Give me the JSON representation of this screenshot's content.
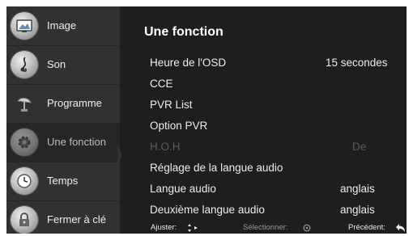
{
  "sidebar": {
    "items": [
      {
        "label": "Image",
        "icon": "image-icon"
      },
      {
        "label": "Son",
        "icon": "music-note-icon"
      },
      {
        "label": "Programme",
        "icon": "satellite-dish-icon"
      },
      {
        "label": "Une fonction",
        "icon": "gear-icon",
        "active": true
      },
      {
        "label": "Temps",
        "icon": "clock-icon"
      },
      {
        "label": "Fermer à clé",
        "icon": "lock-icon"
      }
    ]
  },
  "main": {
    "title": "Une fonction",
    "rows": [
      {
        "label": "Heure de l'OSD",
        "value": "15 secondes"
      },
      {
        "label": "CCE",
        "value": ""
      },
      {
        "label": "PVR List",
        "value": ""
      },
      {
        "label": "Option PVR",
        "value": ""
      },
      {
        "label": "H.O.H",
        "value": "De",
        "disabled": true
      },
      {
        "label": "Réglage de la langue audio",
        "value": ""
      },
      {
        "label": "Langue audio",
        "value": "anglais"
      },
      {
        "label": "Deuxième langue audio",
        "value": "anglais"
      }
    ]
  },
  "footer": {
    "adjust_label": "Ajuster:",
    "select_label": "Sélectionner:",
    "back_label": "Précédent:"
  },
  "colors": {
    "background": "#1e1e1e",
    "sidebar": "#313131",
    "text": "#ededed",
    "disabled_text": "#5c5c5c"
  }
}
